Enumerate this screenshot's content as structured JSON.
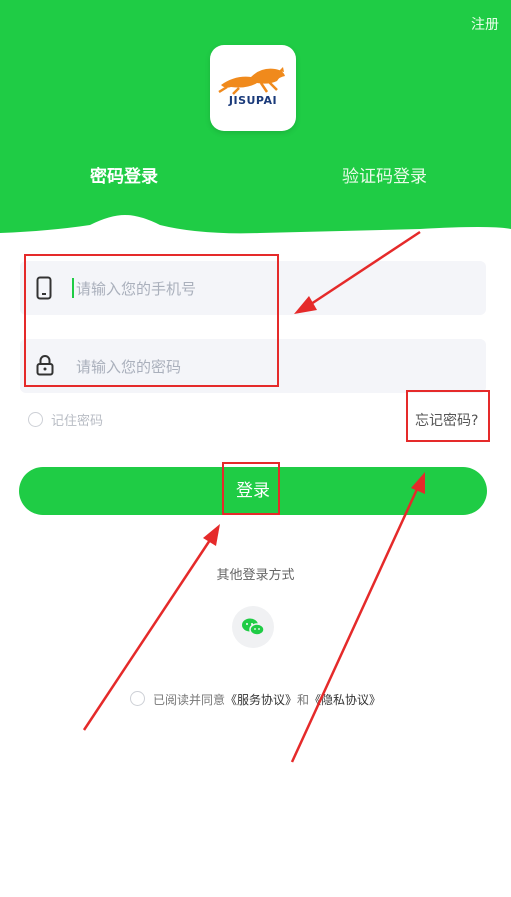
{
  "header": {
    "register_label": "注册"
  },
  "logo": {
    "text": "JISUPAI"
  },
  "tabs": [
    {
      "label": "密码登录"
    },
    {
      "label": "验证码登录"
    }
  ],
  "form": {
    "phone_placeholder": "请输入您的手机号",
    "password_placeholder": "请输入您的密码",
    "remember_label": "记住密码",
    "forgot_label": "忘记密码?"
  },
  "login_label": "登录",
  "other_login_label": "其他登录方式",
  "agreement": {
    "prefix": "已阅读并同意",
    "service": "《服务协议》",
    "and": "和",
    "privacy": "《隐私协议》"
  },
  "colors": {
    "brand_green": "#1fcc45",
    "annotation_red": "#e52a2a"
  }
}
